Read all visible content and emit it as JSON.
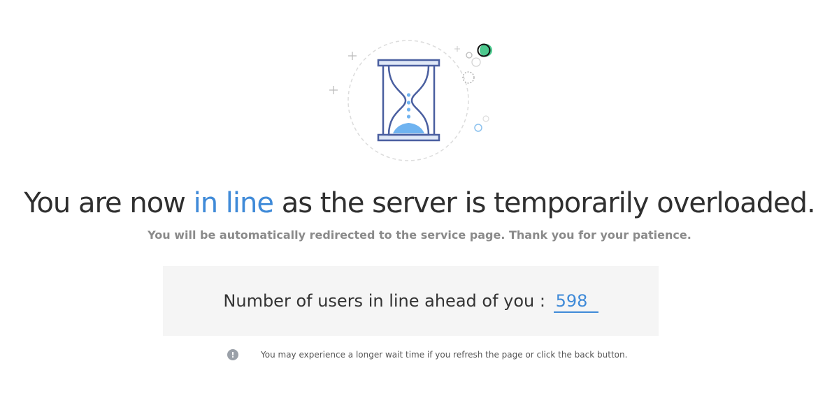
{
  "headline": {
    "prefix": "You are now ",
    "highlight": "in line",
    "suffix": " as the server is temporarily overloaded."
  },
  "subtitle": "You will be automatically redirected to the service page. Thank you for your patience.",
  "queue": {
    "label": "Number of users in line ahead of you : ",
    "count": "598"
  },
  "notice": {
    "icon": "exclamation-icon",
    "icon_glyph": "!",
    "text": "You may experience a longer wait time if you refresh the page or click the back button."
  },
  "colors": {
    "accent": "#3f8ad8",
    "hourglass": "#4a5fa0",
    "sand": "#6fb3f0",
    "dot_green": "#4cc98e"
  }
}
